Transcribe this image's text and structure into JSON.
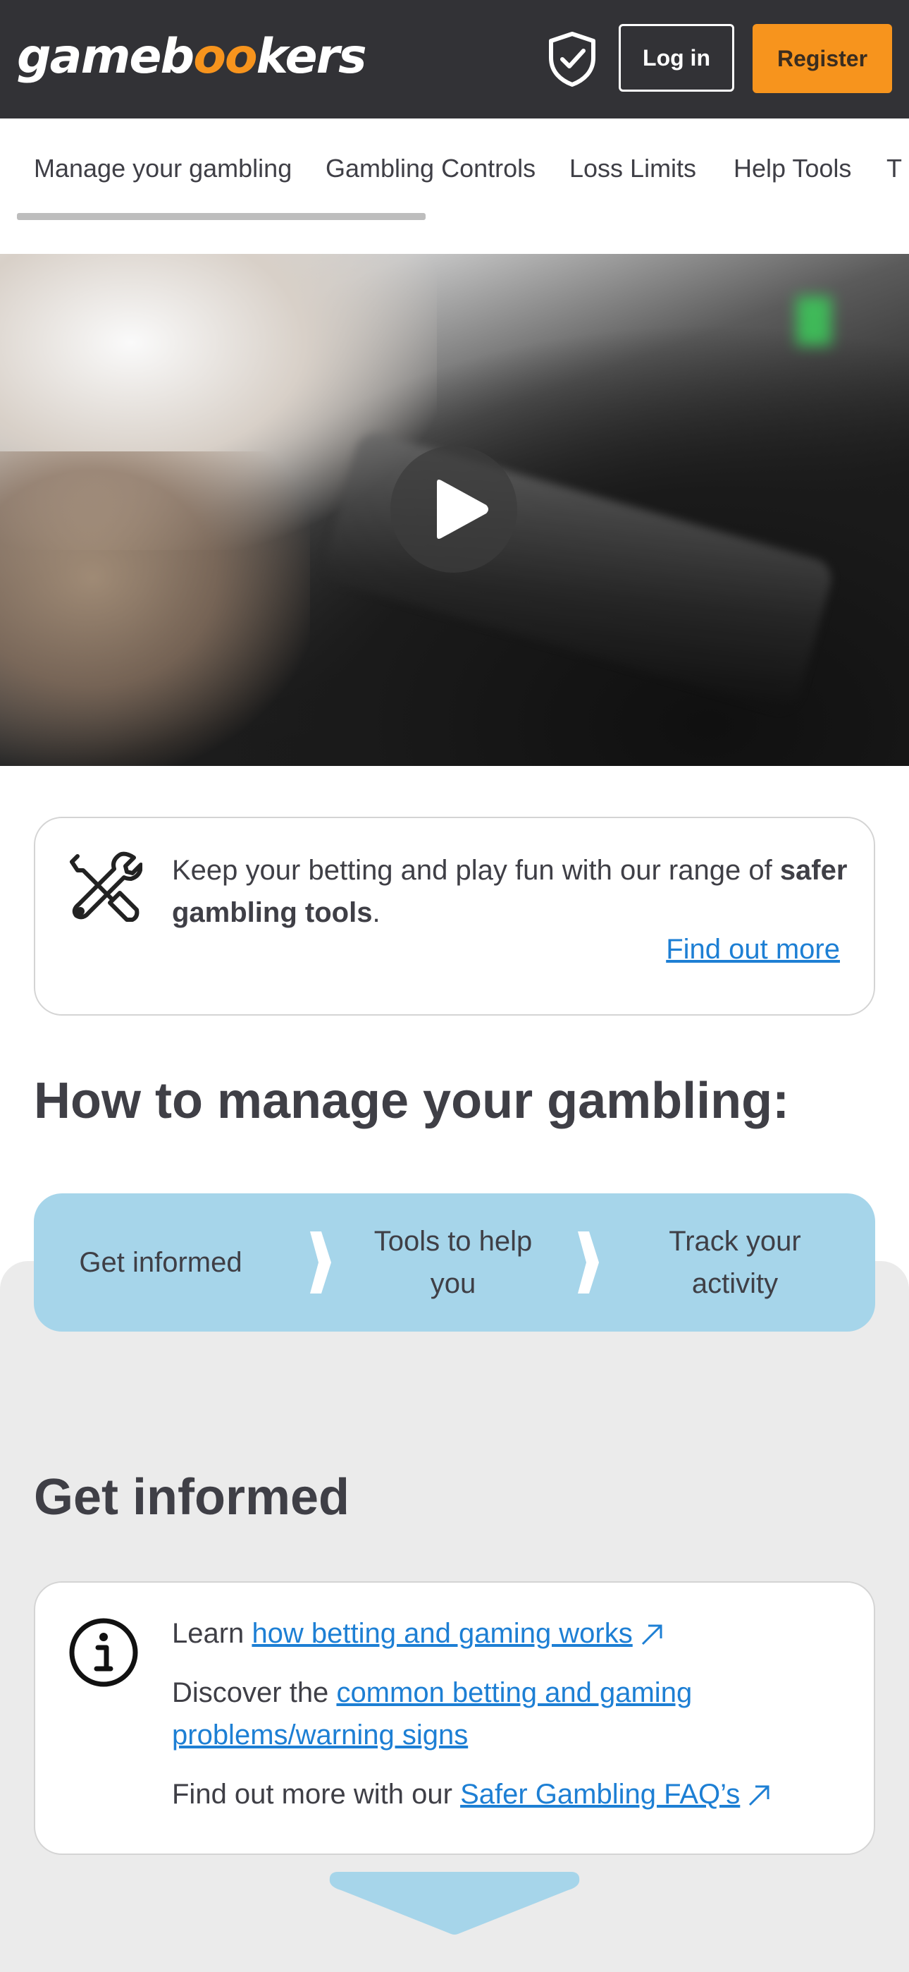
{
  "header": {
    "logo": {
      "part1": "gameb",
      "oo": "oo",
      "part2": "kers"
    },
    "login_label": "Log in",
    "register_label": "Register",
    "colors": {
      "background": "#323236",
      "accent": "#f7941d"
    }
  },
  "tabs": [
    {
      "label": "Manage your gambling",
      "active": true
    },
    {
      "label": "Gambling Controls"
    },
    {
      "label": "Loss Limits"
    },
    {
      "label": "Help Tools"
    },
    {
      "label": "T"
    }
  ],
  "promo": {
    "text_before": "Keep your betting and play fun with our range of",
    "text_bold": "safer gambling tools",
    "text_after": ".",
    "link": "Find out more"
  },
  "manage_heading": "How to manage your gambling:",
  "steps": [
    {
      "label": "Get informed"
    },
    {
      "label": "Tools to help you"
    },
    {
      "label": "Track your activity"
    }
  ],
  "informed_heading": "Get informed",
  "info_card": {
    "line1": {
      "prefix": "Learn",
      "link": "how betting and gaming works"
    },
    "line2": {
      "prefix": "Discover the",
      "link": "common betting and gaming problems/warning signs"
    },
    "line3": {
      "prefix": "Find out more with our",
      "link": "Safer Gambling FAQ’s"
    }
  },
  "icons": [
    "shield-check-icon",
    "play-icon",
    "tools-icon",
    "chevron-right-icon",
    "info-icon",
    "external-link-icon",
    "chevron-down-icon"
  ]
}
